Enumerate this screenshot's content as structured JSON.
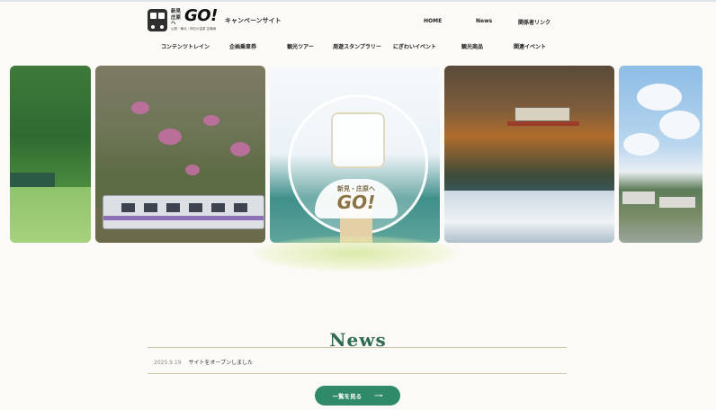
{
  "header": {
    "logo_small": "新見\n庄原へ",
    "logo_go": "GO!",
    "logo_sub": "山間・備北・神石の温泉 芸備線",
    "campaign": "キャンペーンサイト"
  },
  "topnav": [
    "HOME",
    "News",
    "関係者リンク"
  ],
  "mainnav": [
    "コンテンツトレイン",
    "企画乗車券",
    "観光ツアー",
    "周遊スタンプラリー",
    "にぎわいイベント",
    "観光商品",
    "関連イベント"
  ],
  "hero": {
    "center_small": "新見・庄原へ",
    "center_go": "GO!"
  },
  "news": {
    "title": "News",
    "items": [
      {
        "date": "2025.9.19",
        "text": "サイトをオープンしました"
      }
    ],
    "more_label": "一覧を見る",
    "more_arrow": "⟶"
  },
  "colors": {
    "accent": "#2f8a6a",
    "title": "#2f6a52"
  }
}
